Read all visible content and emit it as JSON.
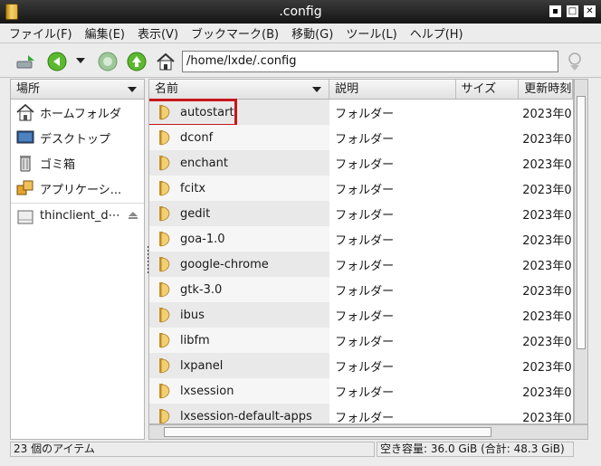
{
  "window": {
    "title": ".config"
  },
  "menu": [
    "ファイル(F)",
    "編集(E)",
    "表示(V)",
    "ブックマーク(B)",
    "移動(G)",
    "ツール(L)",
    "ヘルプ(H)"
  ],
  "toolbar": {
    "path": "/home/lxde/.config"
  },
  "sidebar": {
    "header": "場所",
    "items": [
      {
        "label": "ホームフォルダ",
        "icon": "home-icon"
      },
      {
        "label": "デスクトップ",
        "icon": "desktop-icon"
      },
      {
        "label": "ゴミ箱",
        "icon": "trash-icon"
      },
      {
        "label": "アプリケーシ...",
        "icon": "applications-icon"
      },
      {
        "label": "thinclient_d⋯",
        "icon": "drive-icon"
      }
    ]
  },
  "columns": {
    "name": "名前",
    "desc": "説明",
    "size": "サイズ",
    "modified": "更新時刻"
  },
  "files": [
    {
      "name": "autostart",
      "desc": "フォルダー",
      "date": "2023年0"
    },
    {
      "name": "dconf",
      "desc": "フォルダー",
      "date": "2023年0"
    },
    {
      "name": "enchant",
      "desc": "フォルダー",
      "date": "2023年0"
    },
    {
      "name": "fcitx",
      "desc": "フォルダー",
      "date": "2023年0"
    },
    {
      "name": "gedit",
      "desc": "フォルダー",
      "date": "2023年0"
    },
    {
      "name": "goa-1.0",
      "desc": "フォルダー",
      "date": "2023年0"
    },
    {
      "name": "google-chrome",
      "desc": "フォルダー",
      "date": "2023年0"
    },
    {
      "name": "gtk-3.0",
      "desc": "フォルダー",
      "date": "2023年0"
    },
    {
      "name": "ibus",
      "desc": "フォルダー",
      "date": "2023年0"
    },
    {
      "name": "libfm",
      "desc": "フォルダー",
      "date": "2023年0"
    },
    {
      "name": "lxpanel",
      "desc": "フォルダー",
      "date": "2023年0"
    },
    {
      "name": "lxsession",
      "desc": "フォルダー",
      "date": "2023年0"
    },
    {
      "name": "lxsession-default-apps",
      "desc": "フォルダー",
      "date": "2023年0"
    }
  ],
  "status": {
    "items": "23 個のアイテム",
    "free": "空き容量: 36.0 GiB (合計: 48.3 GiB)"
  },
  "colors": {
    "highlight": "#c8161d",
    "folder": "#e8b84a"
  }
}
